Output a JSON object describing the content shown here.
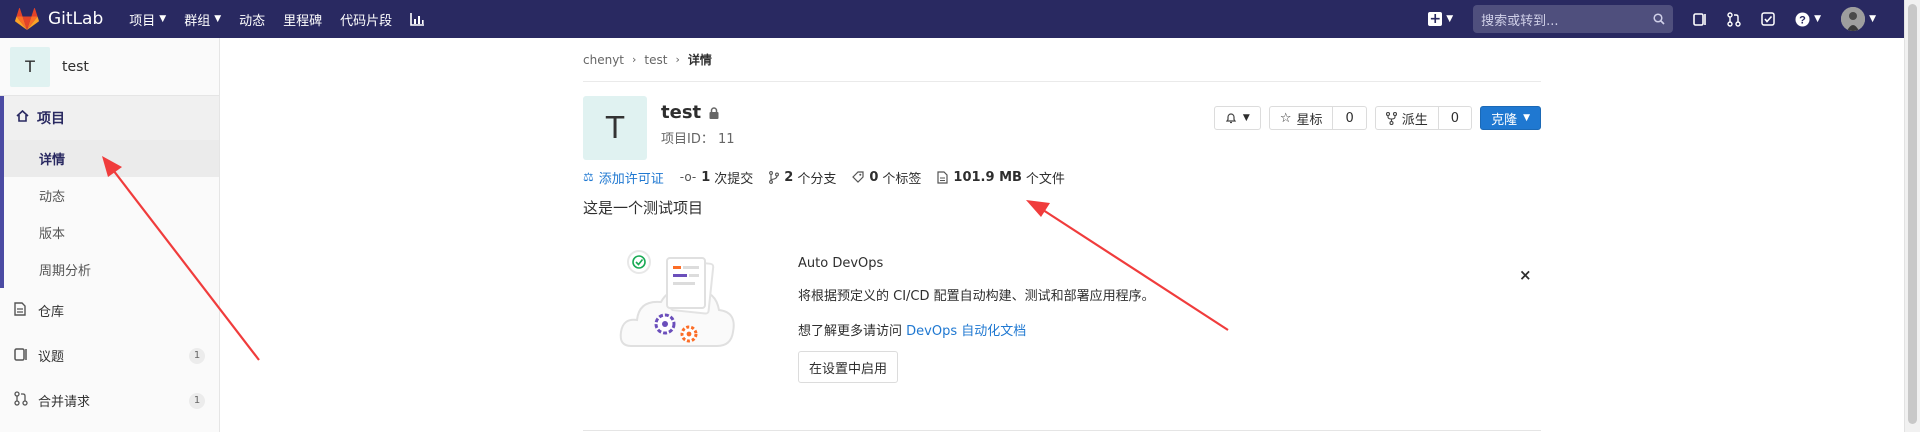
{
  "nav": {
    "brand": "GitLab",
    "menu": [
      {
        "label": "项目",
        "caret": true
      },
      {
        "label": "群组",
        "caret": true
      },
      {
        "label": "动态",
        "caret": false
      },
      {
        "label": "里程碑",
        "caret": false
      },
      {
        "label": "代码片段",
        "caret": false
      }
    ],
    "search_placeholder": "搜索或转到..."
  },
  "sidebar": {
    "project_initial": "T",
    "project_name": "test",
    "section_label": "项目",
    "sub_items": [
      "详情",
      "动态",
      "版本",
      "周期分析"
    ],
    "items": [
      {
        "label": "仓库",
        "icon": "document-icon",
        "badge": ""
      },
      {
        "label": "议题",
        "icon": "issues-icon",
        "badge": "1"
      },
      {
        "label": "合并请求",
        "icon": "merge-request-icon",
        "badge": "1"
      }
    ]
  },
  "breadcrumb": [
    "chenyt",
    "test",
    "详情"
  ],
  "project": {
    "initial": "T",
    "name": "test",
    "id_label": "项目ID： 11",
    "star_label": "星标",
    "star_count": "0",
    "fork_label": "派生",
    "fork_count": "0",
    "clone_label": "克隆",
    "add_license": "添加许可证",
    "commits_num": "1",
    "commits_label": "次提交",
    "branches_num": "2",
    "branches_label": "个分支",
    "tags_num": "0",
    "tags_label": "个标签",
    "files_size": "101.9 MB",
    "files_label": "个文件",
    "description": "这是一个测试项目"
  },
  "devops": {
    "title": "Auto DevOps",
    "line1": "将根据预定义的 CI/CD 配置自动构建、测试和部署应用程序。",
    "line2_prefix": "想了解更多请访问 ",
    "line2_link": "DevOps 自动化文档",
    "button": "在设置中启用",
    "close": "×"
  },
  "colors": {
    "nav_bg": "#292961",
    "accent": "#1f78d1",
    "annotation_arrow": "#f03c3c"
  }
}
